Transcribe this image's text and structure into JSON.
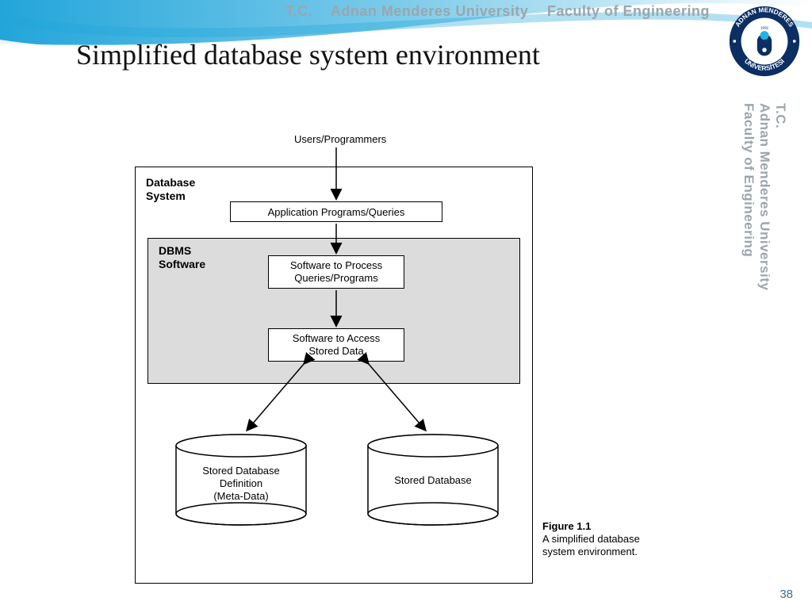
{
  "header": {
    "tc": "T.C.",
    "university": "Adnan Menderes University",
    "faculty": "Faculty of Engineering",
    "seal_top": "ADNAN MENDERES",
    "seal_bottom": "ÜNİVERSİTESİ",
    "seal_year": "1992"
  },
  "side": {
    "tc": "T.C.",
    "university": "Adnan Menderes University",
    "faculty": "Faculty of Engineering"
  },
  "title": "Simplified database system environment",
  "diagram": {
    "top_label": "Users/Programmers",
    "outer_label_l1": "Database",
    "outer_label_l2": "System",
    "inner_label_l1": "DBMS",
    "inner_label_l2": "Software",
    "box1": "Application Programs/Queries",
    "box2_l1": "Software to Process",
    "box2_l2": "Queries/Programs",
    "box3_l1": "Software to Access",
    "box3_l2": "Stored Data",
    "cyl1_l1": "Stored Database",
    "cyl1_l2": "Definition",
    "cyl1_l3": "(Meta-Data)",
    "cyl2": "Stored Database"
  },
  "caption": {
    "fig_no": "Figure 1.1",
    "text_l1": "A simplified database",
    "text_l2": "system environment."
  },
  "page_number": "38"
}
